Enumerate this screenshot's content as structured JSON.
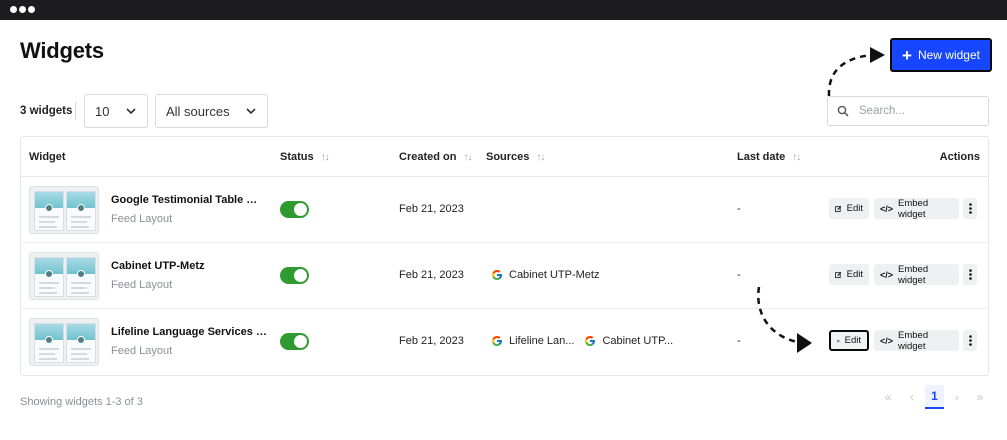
{
  "header": {
    "title": "Widgets",
    "new_button_label": "New widget"
  },
  "toolbar": {
    "count_label": "3 widgets",
    "page_size": "10",
    "source_filter": "All sources",
    "search_placeholder": "Search..."
  },
  "table": {
    "columns": [
      "Widget",
      "Status",
      "Created on",
      "Sources",
      "Last date",
      "Actions"
    ],
    "rows": [
      {
        "name": "Google Testimonial Table Wid...",
        "type": "Feed Layout",
        "status_on": true,
        "created": "Feb 21, 2023",
        "sources": [],
        "last_date": "-"
      },
      {
        "name": "Cabinet UTP-Metz",
        "type": "Feed Layout",
        "status_on": true,
        "created": "Feb 21, 2023",
        "sources": [
          "Cabinet UTP-Metz"
        ],
        "last_date": "-"
      },
      {
        "name": "Lifeline Language Services Lt...",
        "type": "Feed Layout",
        "status_on": true,
        "created": "Feb 21, 2023",
        "sources": [
          "Lifeline Lan...",
          "Cabinet UTP..."
        ],
        "last_date": "-"
      }
    ],
    "actions": {
      "edit_label": "Edit",
      "embed_label": "Embed widget"
    }
  },
  "footer": {
    "showing_text": "Showing widgets 1-3 of 3",
    "pagination": {
      "first": "«",
      "prev": "‹",
      "current": "1",
      "next": "›",
      "last": "»"
    }
  },
  "colors": {
    "primary": "#1646ff",
    "toggle_on": "#2f9a2f",
    "titlebar": "#1c1c1f"
  },
  "icons": [
    "search-icon",
    "chevron-down-icon",
    "plus-icon",
    "sort-icon",
    "google-icon",
    "edit-icon",
    "code-icon",
    "kebab-menu-icon"
  ]
}
